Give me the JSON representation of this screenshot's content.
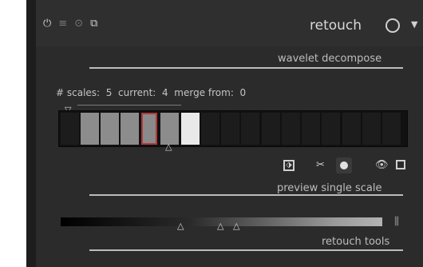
{
  "header": {
    "title": "retouch",
    "icons": [
      "power-icon",
      "menu-icon",
      "presets-icon",
      "copy-icon",
      "mask-toggle-icon",
      "collapse-arrow-icon"
    ]
  },
  "wavelet": {
    "section_title": "wavelet decompose",
    "scales_label": "# scales:",
    "scales_value": "5",
    "current_label": "current:",
    "current_value": "4",
    "merge_label": "merge from:",
    "merge_value": "0",
    "cell_count": 17,
    "selected_cell": 4
  },
  "preview": {
    "section_title": "preview single scale",
    "icons": [
      "color-picker-icon",
      "scissors-icon",
      "dot-icon",
      "eye-icon",
      "square-icon"
    ]
  },
  "retouch_tools": {
    "section_title": "retouch tools",
    "icons": [
      "levels-icon"
    ]
  },
  "colors": {
    "accent_red": "#b03a3a",
    "background": "#2b2b2b"
  }
}
